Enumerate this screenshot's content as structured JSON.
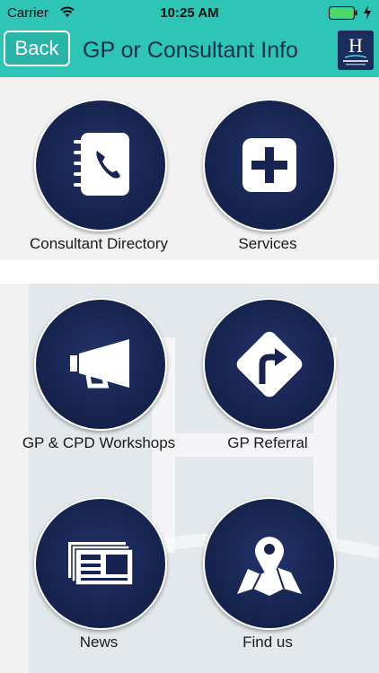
{
  "status_bar": {
    "carrier": "Carrier",
    "time": "10:25 AM",
    "wifi_icon": "wifi-icon",
    "battery_icon": "battery-icon",
    "charge_icon": "charging-bolt-icon"
  },
  "navbar": {
    "back_label": "Back",
    "title": "GP or Consultant Info",
    "logo_icon": "hermitage-logo-icon",
    "color": "#2ec4b6",
    "title_color": "#16304f"
  },
  "tiles": [
    {
      "label": "Consultant Directory",
      "icon": "address-book-phone-icon"
    },
    {
      "label": "Services",
      "icon": "medical-cross-icon"
    },
    {
      "label": "GP & CPD Workshops",
      "icon": "megaphone-icon"
    },
    {
      "label": "GP Referral",
      "icon": "turn-right-sign-icon"
    },
    {
      "label": "News",
      "icon": "newspapers-icon"
    },
    {
      "label": "Find us",
      "icon": "map-pin-icon"
    }
  ],
  "colors": {
    "circle": "#17244f",
    "background": "#f2f2f2"
  }
}
